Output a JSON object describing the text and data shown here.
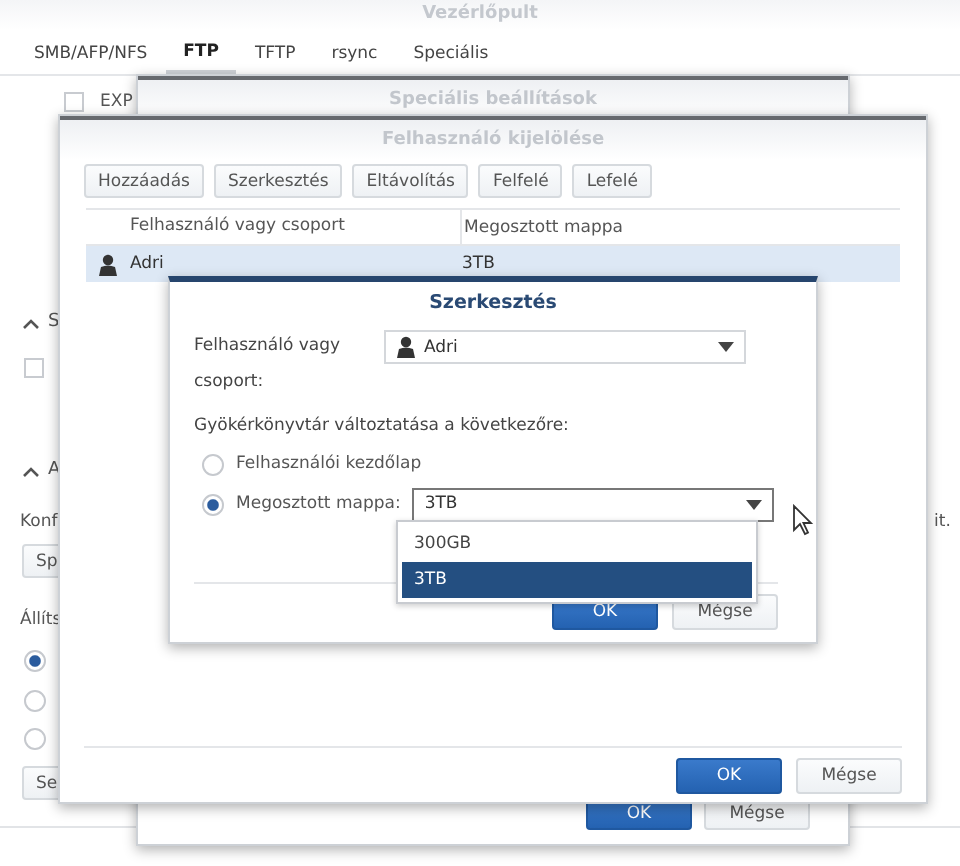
{
  "window": {
    "title": "Vezérlőpult"
  },
  "tabs": [
    {
      "label": "SMB/AFP/NFS",
      "selected": false
    },
    {
      "label": "FTP",
      "selected": true
    },
    {
      "label": "TFTP",
      "selected": false
    },
    {
      "label": "rsync",
      "selected": false
    },
    {
      "label": "Speciális",
      "selected": false
    }
  ],
  "panel": {
    "option": {
      "label": "EXP",
      "checked": false
    },
    "sections": [
      {
        "title": "S",
        "expanded": true
      },
      {
        "title": "A",
        "expanded": true
      }
    ],
    "section_checkbox": {
      "checked": false
    },
    "description": "Konf",
    "description_end": "it.",
    "button_1": "Sp",
    "setting_label": "Állíts",
    "radios": [
      {
        "selected": true
      },
      {
        "selected": false
      },
      {
        "selected": false
      }
    ],
    "button_2": "Se"
  },
  "advanced_dialog": {
    "title": "Speciális beállítások",
    "buttons": [
      {
        "label": "OK",
        "primary": true
      },
      {
        "label": "Mégse",
        "primary": false
      }
    ]
  },
  "user_dialog": {
    "title": "Felhasználó kijelölése",
    "toolbar": [
      "Hozzáadás",
      "Szerkesztés",
      "Eltávolítás",
      "Felfelé",
      "Lefelé"
    ],
    "columns": [
      "Felhasználó vagy csoport",
      "Megosztott mappa"
    ],
    "rows": [
      {
        "user": "Adri",
        "folder": "3TB",
        "selected": true
      }
    ],
    "buttons": [
      {
        "label": "OK",
        "primary": true
      },
      {
        "label": "Mégse",
        "primary": false
      }
    ]
  },
  "edit_dialog": {
    "title": "Szerkesztés",
    "user_label": "Felhasználó vagy csoport:",
    "user_value": "Adri",
    "root_label": "Gyökérkönyvtár változtatása a következőre:",
    "options": [
      {
        "label": "Felhasználói kezdőlap",
        "selected": false
      },
      {
        "label": "Megosztott mappa:",
        "selected": true
      }
    ],
    "folder_value": "3TB",
    "dropdown": [
      {
        "label": "300GB",
        "selected": false
      },
      {
        "label": "3TB",
        "selected": true
      }
    ],
    "buttons": [
      {
        "label": "OK",
        "primary": true
      },
      {
        "label": "Mégse",
        "primary": false
      }
    ]
  }
}
